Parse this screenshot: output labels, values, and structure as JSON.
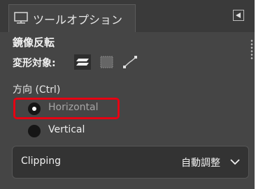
{
  "tab": {
    "title": "ツールオプション",
    "icon": "tool-options-icon",
    "menu_icon": "tab-menu-icon"
  },
  "tool": {
    "name": "鏡像反転"
  },
  "transform": {
    "label": "変形対象:",
    "targets": [
      {
        "name": "layer",
        "icon": "layer-target-icon",
        "selected": true
      },
      {
        "name": "selection",
        "icon": "selection-target-icon",
        "selected": false
      },
      {
        "name": "path",
        "icon": "path-target-icon",
        "selected": false
      }
    ]
  },
  "direction": {
    "label": "方向 (Ctrl)",
    "options": [
      {
        "label": "Horizontal",
        "selected": true
      },
      {
        "label": "Vertical",
        "selected": false
      }
    ]
  },
  "clipping": {
    "label": "Clipping",
    "value": "自動調整",
    "icon": "chevron-down-icon"
  },
  "colors": {
    "panel": "#454545",
    "tabbar": "#3a3a3a",
    "highlight": "#e60012",
    "field": "#333333"
  }
}
